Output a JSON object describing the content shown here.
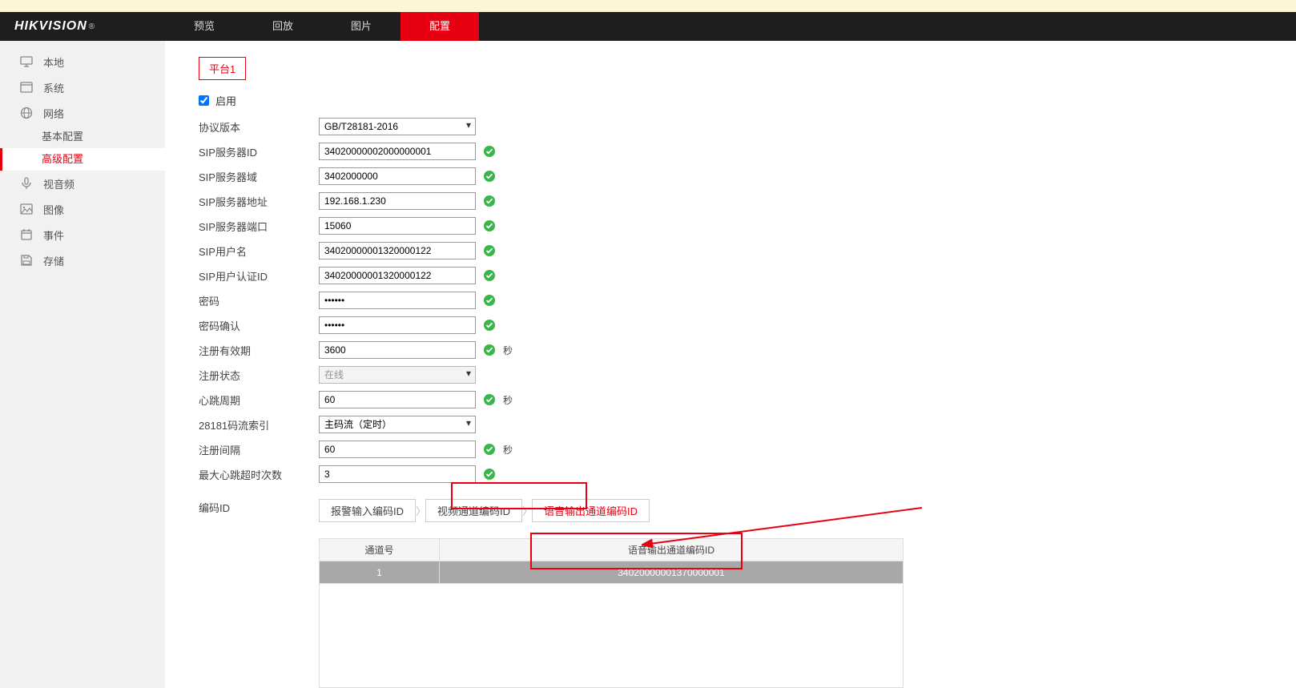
{
  "logo": "HIKVISION",
  "nav": {
    "preview": "预览",
    "playback": "回放",
    "image": "图片",
    "config": "配置"
  },
  "sidebar": {
    "local": "本地",
    "system": "系统",
    "network": "网络",
    "network_basic": "基本配置",
    "network_adv": "高级配置",
    "av": "视音频",
    "imageMenu": "图像",
    "event": "事件",
    "storage": "存储"
  },
  "subtab": {
    "platform1": "平台1"
  },
  "form": {
    "enable": "启用",
    "protocol_label": "协议版本",
    "protocol_value": "GB/T28181-2016",
    "sip_id_label": "SIP服务器ID",
    "sip_id_value": "34020000002000000001",
    "sip_domain_label": "SIP服务器域",
    "sip_domain_value": "3402000000",
    "sip_addr_label": "SIP服务器地址",
    "sip_addr_value": "192.168.1.230",
    "sip_port_label": "SIP服务器端口",
    "sip_port_value": "15060",
    "sip_user_label": "SIP用户名",
    "sip_user_value": "34020000001320000122",
    "sip_auth_label": "SIP用户认证ID",
    "sip_auth_value": "34020000001320000122",
    "pwd_label": "密码",
    "pwd_value": "••••••",
    "pwd2_label": "密码确认",
    "pwd2_value": "••••••",
    "reg_valid_label": "注册有效期",
    "reg_valid_value": "3600",
    "reg_status_label": "注册状态",
    "reg_status_value": "在线",
    "heartbeat_label": "心跳周期",
    "heartbeat_value": "60",
    "stream_label": "28181码流索引",
    "stream_value": "主码流（定时）",
    "reg_interval_label": "注册间隔",
    "reg_interval_value": "60",
    "max_hb_label": "最大心跳超时次数",
    "max_hb_value": "3",
    "encode_id_label": "编码ID",
    "sec_unit": "秒"
  },
  "crumbs": {
    "alarm": "报警输入编码ID",
    "video": "视频通道编码ID",
    "audio": "语音输出通道编码ID"
  },
  "table": {
    "col_channel": "通道号",
    "col_audio_id": "语音输出通道编码ID",
    "row1_ch": "1",
    "row1_id": "34020000001370000001"
  }
}
